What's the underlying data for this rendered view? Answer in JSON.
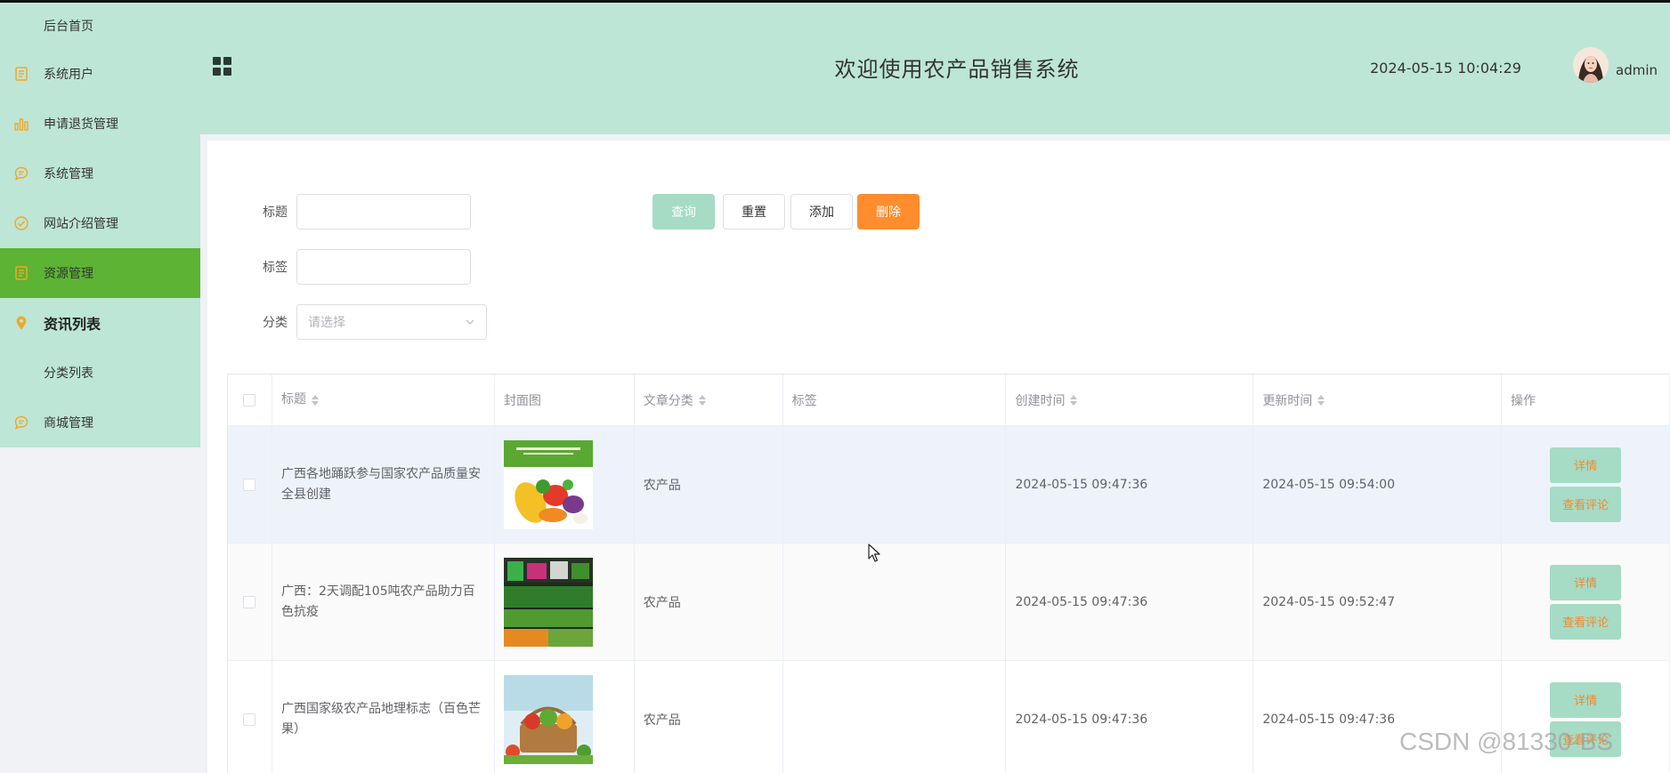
{
  "sidebar": {
    "items": [
      {
        "label": "后台首页",
        "icon": "none"
      },
      {
        "label": "系统用户",
        "icon": "document-icon"
      },
      {
        "label": "申请退货管理",
        "icon": "bar-chart-icon"
      },
      {
        "label": "系统管理",
        "icon": "chat-icon"
      },
      {
        "label": "网站介绍管理",
        "icon": "check-circle-icon"
      },
      {
        "label": "资源管理",
        "icon": "document-icon",
        "active": true
      },
      {
        "label": "资讯列表",
        "icon": "location-pin-icon"
      },
      {
        "label": "分类列表",
        "icon": "none"
      },
      {
        "label": "商城管理",
        "icon": "chat-icon"
      }
    ]
  },
  "header": {
    "title": "欢迎使用农产品销售系统",
    "datetime": "2024-05-15 10:04:29",
    "username": "admin"
  },
  "search": {
    "title_label": "标题",
    "tag_label": "标签",
    "category_label": "分类",
    "category_placeholder": "请选择",
    "title_value": "",
    "tag_value": ""
  },
  "buttons": {
    "query": "查询",
    "reset": "重置",
    "add": "添加",
    "delete": "删除"
  },
  "table": {
    "headers": {
      "title": "标题",
      "cover": "封面图",
      "category": "文章分类",
      "tag": "标签",
      "created": "创建时间",
      "updated": "更新时间",
      "ops": "操作"
    },
    "rows": [
      {
        "title": "广西各地踊跃参与国家农产品质量安全县创建",
        "category": "农产品",
        "tag": "",
        "created": "2024-05-15 09:47:36",
        "updated": "2024-05-15 09:54:00"
      },
      {
        "title": "广西：2天调配105吨农产品助力百色抗疫",
        "category": "农产品",
        "tag": "",
        "created": "2024-05-15 09:47:36",
        "updated": "2024-05-15 09:52:47"
      },
      {
        "title": "广西国家级农产品地理标志（百色芒果）",
        "category": "农产品",
        "tag": "",
        "created": "2024-05-15 09:47:36",
        "updated": "2024-05-15 09:47:36"
      }
    ],
    "op_detail": "详情",
    "op_comments": "查看评论"
  },
  "watermark": "CSDN @81330-BS",
  "colors": {
    "header_bg": "#bde6d6",
    "active_menu": "#5cb334",
    "primary_btn": "#a6dbc6",
    "danger_btn": "#ff8d2e",
    "op_text": "#f5892a"
  }
}
